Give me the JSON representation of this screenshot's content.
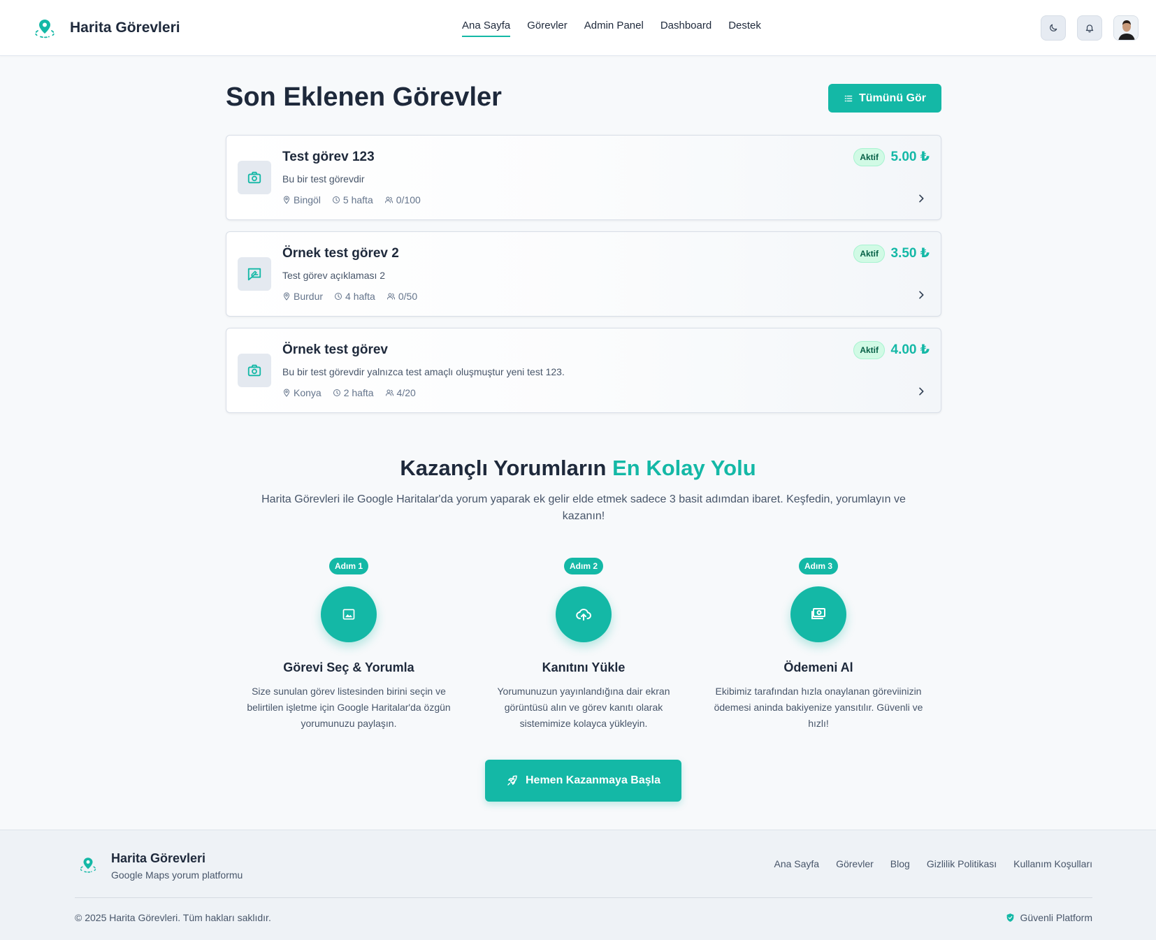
{
  "colors": {
    "accent": "#14b8a6",
    "text_dark": "#1e293b",
    "status_bg": "#d1fae5"
  },
  "header": {
    "brand": "Harita Görevleri",
    "nav": [
      "Ana Sayfa",
      "Görevler",
      "Admin Panel",
      "Dashboard",
      "Destek"
    ],
    "active_nav": "Ana Sayfa",
    "icons": [
      "map-pin-logo-icon",
      "moon-icon",
      "bell-icon",
      "avatar"
    ]
  },
  "recent": {
    "title": "Son Eklenen Görevler",
    "see_all": "Tümünü Gör",
    "tasks": [
      {
        "title": "Test görev 123",
        "desc": "Bu bir test görevdir",
        "location": "Bingöl",
        "duration": "5 hafta",
        "participants": "0/100",
        "status": "Aktif",
        "price": "5.00 ₺",
        "icon": "camera-icon"
      },
      {
        "title": "Örnek test görev 2",
        "desc": "Test görev açıklaması 2",
        "location": "Burdur",
        "duration": "4 hafta",
        "participants": "0/50",
        "status": "Aktif",
        "price": "3.50 ₺",
        "icon": "review-icon"
      },
      {
        "title": "Örnek test görev",
        "desc": "Bu bir test görevdir yalnızca test amaçlı oluşmuştur yeni test 123.",
        "location": "Konya",
        "duration": "2 hafta",
        "participants": "4/20",
        "status": "Aktif",
        "price": "4.00 ₺",
        "icon": "camera-icon"
      }
    ]
  },
  "how": {
    "title_main": "Kazançlı Yorumların ",
    "title_accent": "En Kolay Yolu",
    "subtitle": "Harita Görevleri ile Google Haritalar'da yorum yaparak ek gelir elde etmek sadece 3 basit adımdan ibaret. Keşfedin, yorumlayın ve kazanın!",
    "steps": [
      {
        "badge": "Adım 1",
        "title": "Görevi Seç & Yorumla",
        "desc": "Size sunulan görev listesinden birini seçin ve belirtilen işletme için Google Haritalar'da özgün yorumunuzu paylaşın.",
        "icon": "image-icon"
      },
      {
        "badge": "Adım 2",
        "title": "Kanıtını Yükle",
        "desc": "Yorumunuzun yayınlandığına dair ekran görüntüsü alın ve görev kanıtı olarak sistemimize kolayca yükleyin.",
        "icon": "cloud-upload-icon"
      },
      {
        "badge": "Adım 3",
        "title": "Ödemeni Al",
        "desc": "Ekibimiz tarafından hızla onaylanan göreviinizin ödemesi aninda bakiyenize yansıtılır. Güvenli ve hızlı!",
        "icon": "money-icon"
      }
    ],
    "cta": "Hemen Kazanmaya Başla"
  },
  "footer": {
    "name": "Harita Görevleri",
    "tagline": "Google Maps yorum platformu",
    "links": [
      "Ana Sayfa",
      "Görevler",
      "Blog",
      "Gizlilik Politikası",
      "Kullanım Koşulları"
    ],
    "copyright": "© 2025 Harita Görevleri. Tüm hakları saklıdır.",
    "secure": "Güvenli Platform"
  }
}
